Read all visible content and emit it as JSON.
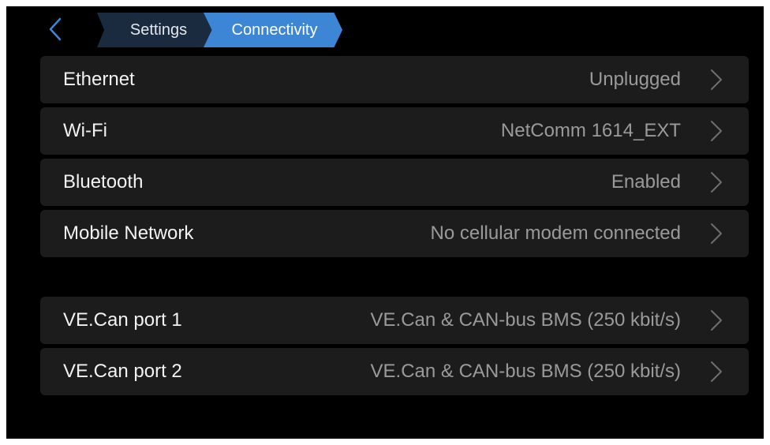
{
  "breadcrumb": {
    "back_icon": "chevron-left-icon",
    "items": [
      {
        "label": "Settings"
      },
      {
        "label": "Connectivity"
      }
    ]
  },
  "colors": {
    "background": "#000000",
    "row_background": "#1c1c1c",
    "crumb_inactive": "#1b2b3f",
    "crumb_active": "#3d86d6",
    "label_text": "#f2f2f2",
    "value_text": "#9a9a9a"
  },
  "rows": [
    {
      "label": "Ethernet",
      "value": "Unplugged",
      "icon": "chevron-right-icon"
    },
    {
      "label": "Wi-Fi",
      "value": "NetComm 1614_EXT",
      "icon": "chevron-right-icon"
    },
    {
      "label": "Bluetooth",
      "value": "Enabled",
      "icon": "chevron-right-icon"
    },
    {
      "label": "Mobile Network",
      "value": "No cellular modem connected",
      "icon": "chevron-right-icon"
    },
    {
      "label": "VE.Can port 1",
      "value": "VE.Can & CAN-bus BMS (250 kbit/s)",
      "icon": "chevron-right-icon"
    },
    {
      "label": "VE.Can port 2",
      "value": "VE.Can & CAN-bus BMS (250 kbit/s)",
      "icon": "chevron-right-icon"
    }
  ]
}
